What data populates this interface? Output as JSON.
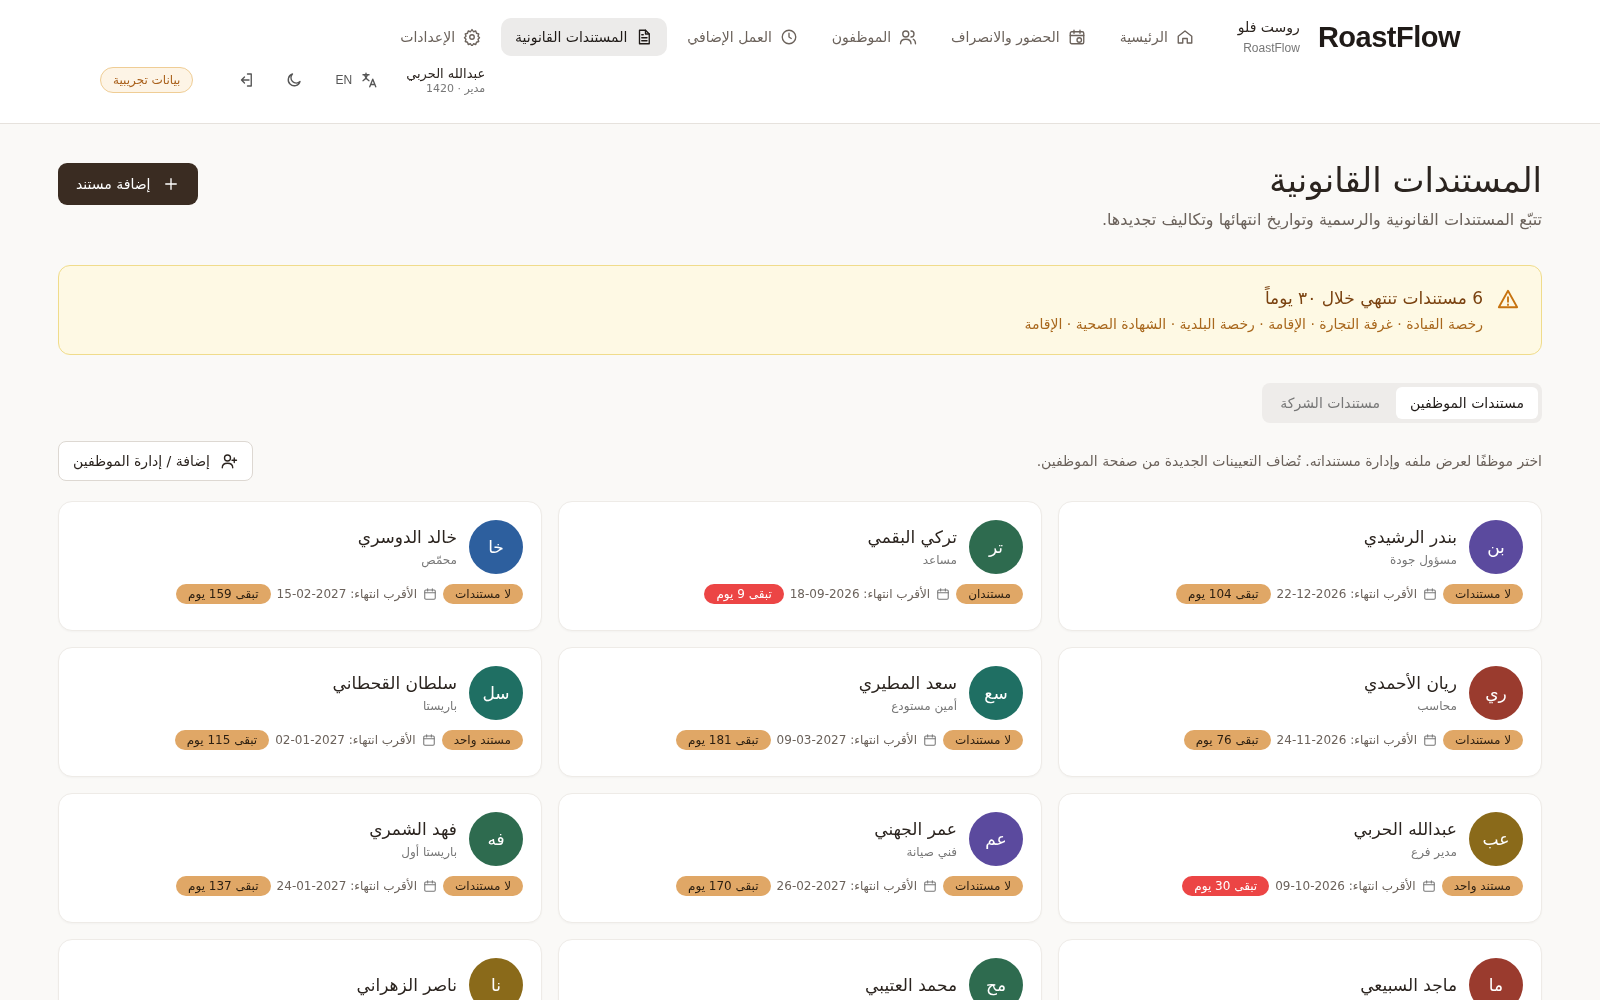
{
  "header": {
    "logo": "RoastFlow",
    "brand_ar": "روست فلو",
    "brand_en": "RoastFlow",
    "nav": [
      {
        "label": "الرئيسية",
        "selected": false
      },
      {
        "label": "الحضور والانصراف",
        "selected": false
      },
      {
        "label": "الموظفون",
        "selected": false
      },
      {
        "label": "العمل الإضافي",
        "selected": false
      },
      {
        "label": "المستندات القانونية",
        "selected": true
      },
      {
        "label": "الإعدادات",
        "selected": false
      }
    ],
    "user": {
      "name": "عبدالله الحربي",
      "meta": "مدير · 1420"
    },
    "language": "EN",
    "demo_badge": "بيانات تجريبية"
  },
  "page": {
    "title": "المستندات القانونية",
    "subtitle": "تتبّع المستندات القانونية والرسمية وتواريخ انتهائها وتكاليف تجديدها.",
    "add_button": "إضافة مستند"
  },
  "alert": {
    "title": "6 مستندات تنتهي خلال ٣٠ يوماً",
    "details": "رخصة القيادة · غرفة التجارة · الإقامة · رخصة البلدية · الشهادة الصحية · الإقامة"
  },
  "tabs": [
    {
      "label": "مستندات الموظفين",
      "selected": true
    },
    {
      "label": "مستندات الشركة",
      "selected": false
    }
  ],
  "hint": "اختر موظفًا لعرض ملفه وإدارة مستنداته. تُضاف التعيينات الجديدة من صفحة الموظفين.",
  "manage_button": "إضافة / إدارة الموظفين",
  "employees": [
    {
      "initials": "بن",
      "color": "#5b4a9e",
      "name": "بندر الرشيدي",
      "role": "مسؤول جودة",
      "docs": "لا مستندات",
      "expiry": "الأقرب انتهاء: 2026-12-22",
      "remaining": "تبقى 104 يوم",
      "urgent": false
    },
    {
      "initials": "تر",
      "color": "#2e6b4f",
      "name": "تركي البقمي",
      "role": "مساعد",
      "docs": "مستندان",
      "expiry": "الأقرب انتهاء: 2026-09-18",
      "remaining": "تبقى 9 يوم",
      "urgent": true
    },
    {
      "initials": "خا",
      "color": "#2d5f9e",
      "name": "خالد الدوسري",
      "role": "محمّص",
      "docs": "لا مستندات",
      "expiry": "الأقرب انتهاء: 2027-02-15",
      "remaining": "تبقى 159 يوم",
      "urgent": false
    },
    {
      "initials": "ري",
      "color": "#9a3b2e",
      "name": "ريان الأحمدي",
      "role": "محاسب",
      "docs": "لا مستندات",
      "expiry": "الأقرب انتهاء: 2026-11-24",
      "remaining": "تبقى 76 يوم",
      "urgent": false
    },
    {
      "initials": "سع",
      "color": "#1f6f63",
      "name": "سعد المطيري",
      "role": "أمين مستودع",
      "docs": "لا مستندات",
      "expiry": "الأقرب انتهاء: 2027-03-09",
      "remaining": "تبقى 181 يوم",
      "urgent": false
    },
    {
      "initials": "سل",
      "color": "#1f6f63",
      "name": "سلطان القحطاني",
      "role": "باريستا",
      "docs": "مستند واحد",
      "expiry": "الأقرب انتهاء: 2027-01-02",
      "remaining": "تبقى 115 يوم",
      "urgent": false
    },
    {
      "initials": "عب",
      "color": "#8a6a1a",
      "name": "عبدالله الحربي",
      "role": "مدير فرع",
      "docs": "مستند واحد",
      "expiry": "الأقرب انتهاء: 2026-10-09",
      "remaining": "تبقى 30 يوم",
      "urgent": true
    },
    {
      "initials": "عم",
      "color": "#5b4a9e",
      "name": "عمر الجهني",
      "role": "فني صيانة",
      "docs": "لا مستندات",
      "expiry": "الأقرب انتهاء: 2027-02-26",
      "remaining": "تبقى 170 يوم",
      "urgent": false
    },
    {
      "initials": "فه",
      "color": "#2e6b4f",
      "name": "فهد الشمري",
      "role": "باريستا أول",
      "docs": "لا مستندات",
      "expiry": "الأقرب انتهاء: 2027-01-24",
      "remaining": "تبقى 137 يوم",
      "urgent": false
    },
    {
      "initials": "ما",
      "color": "#9a3b2e",
      "name": "ماجد السبيعي"
    },
    {
      "initials": "مح",
      "color": "#2e6b4f",
      "name": "محمد العتيبي"
    },
    {
      "initials": "نا",
      "color": "#8a6a1a",
      "name": "ناصر الزهراني"
    }
  ]
}
